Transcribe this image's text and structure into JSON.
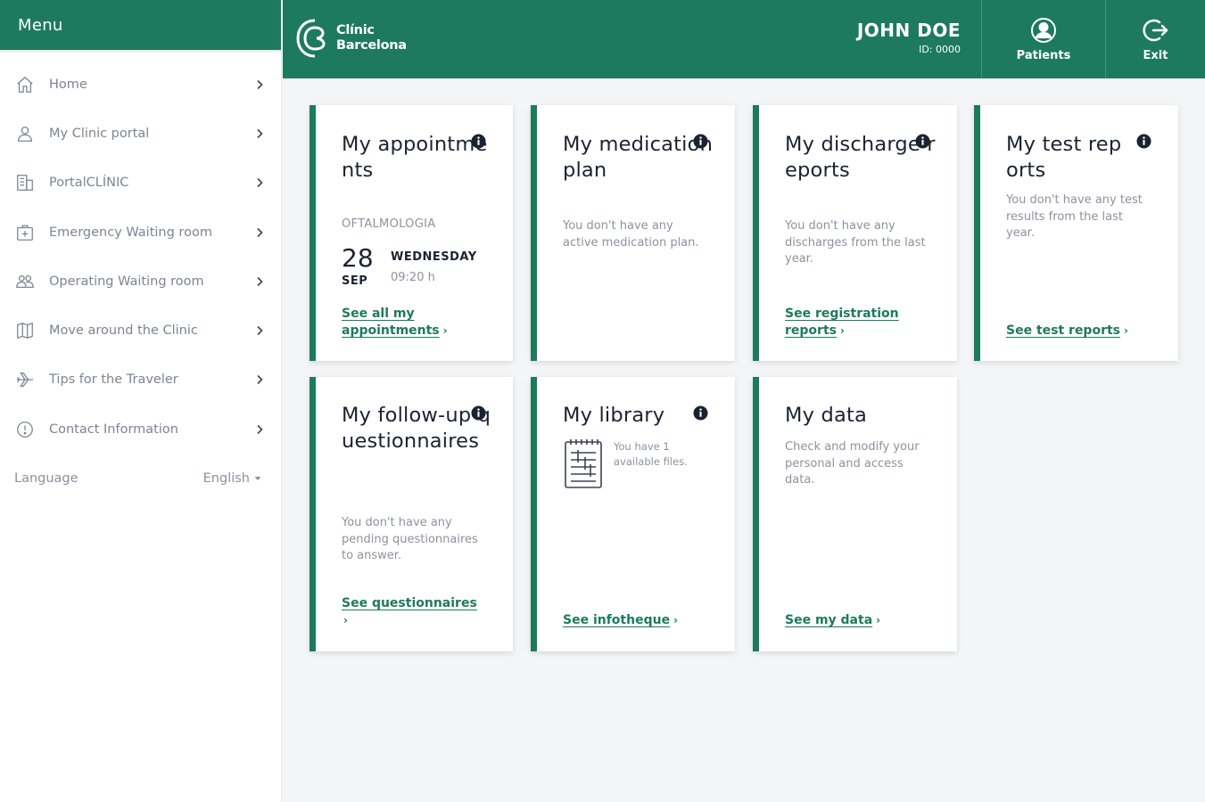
{
  "sidebar": {
    "title": "Menu",
    "items": [
      {
        "label": "Home",
        "icon": "home-icon"
      },
      {
        "label": "My Clinic portal",
        "icon": "user-icon"
      },
      {
        "label": "PortalCLÍNIC",
        "icon": "building-icon"
      },
      {
        "label": "Emergency Waiting room",
        "icon": "medical-bag-icon"
      },
      {
        "label": "Operating Waiting room",
        "icon": "group-icon"
      },
      {
        "label": "Move around the Clinic",
        "icon": "map-icon"
      },
      {
        "label": "Tips for the Traveler",
        "icon": "plane-icon"
      },
      {
        "label": "Contact Information",
        "icon": "info-circle-icon"
      }
    ],
    "language_label": "Language",
    "language_value": "English"
  },
  "header": {
    "logo_line1": "Clínic",
    "logo_line2": "Barcelona",
    "user_name": "JOHN DOE",
    "user_id": "ID: 0000",
    "patients_label": "Patients",
    "exit_label": "Exit"
  },
  "cards": {
    "appointments": {
      "title": "My appointments",
      "department": "OFTALMOLOGIA",
      "day": "28",
      "month": "SEP",
      "weekday": "WEDNESDAY",
      "time": "09:20 h",
      "link_line1": "See all my",
      "link_line2": "appointments"
    },
    "medication": {
      "title": "My medication plan",
      "text": "You don't have any active medication plan."
    },
    "discharge": {
      "title": "My discharge reports",
      "text": "You don't have any discharges from the last year.",
      "link_line1": "See registration",
      "link_line2": "reports"
    },
    "tests": {
      "title": "My test reports",
      "text": "You don't have any test results from the last year.",
      "link": "See test reports"
    },
    "followup": {
      "title": "My follow-up questionnaires",
      "text": "You don't have any pending questionnaires to answer.",
      "link": "See questionnaires"
    },
    "library": {
      "title": "My library",
      "text": "You have 1 available files.",
      "link": "See infotheque"
    },
    "mydata": {
      "title": "My data",
      "text": "Check and modify your personal and access data.",
      "link": "See my data"
    }
  },
  "colors": {
    "brand_green": "#1d7a5d",
    "background": "#f3f5f7",
    "muted_text": "#8b939e"
  }
}
